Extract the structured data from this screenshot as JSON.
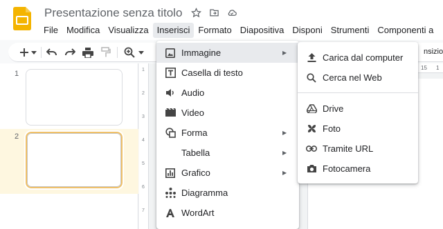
{
  "header": {
    "doc_title": "Presentazione senza titolo"
  },
  "menubar": [
    {
      "label": "File"
    },
    {
      "label": "Modifica"
    },
    {
      "label": "Visualizza"
    },
    {
      "label": "Inserisci",
      "active": true
    },
    {
      "label": "Formato"
    },
    {
      "label": "Diapositiva"
    },
    {
      "label": "Disponi"
    },
    {
      "label": "Strumenti"
    },
    {
      "label": "Componenti a"
    }
  ],
  "toolbar": {
    "clipped_text": "nsizione"
  },
  "filmstrip": {
    "slides": [
      {
        "number": "1"
      },
      {
        "number": "2",
        "selected": true
      }
    ]
  },
  "ruler": {
    "h_marks": [
      "15",
      "1"
    ],
    "v_marks": [
      "1",
      "2",
      "3",
      "4",
      "5",
      "6",
      "7"
    ]
  },
  "insert_menu": {
    "items": [
      {
        "label": "Immagine",
        "icon": "image-icon",
        "submenu": true,
        "highlighted": true
      },
      {
        "label": "Casella di testo",
        "icon": "text-box-icon"
      },
      {
        "label": "Audio",
        "icon": "audio-icon"
      },
      {
        "label": "Video",
        "icon": "video-icon"
      },
      {
        "label": "Forma",
        "icon": "shape-icon",
        "submenu": true
      },
      {
        "label": "Tabella",
        "submenu": true
      },
      {
        "label": "Grafico",
        "icon": "chart-icon",
        "submenu": true
      },
      {
        "label": "Diagramma",
        "icon": "diagram-icon"
      },
      {
        "label": "WordArt",
        "icon": "wordart-icon"
      }
    ]
  },
  "image_submenu": {
    "items": [
      {
        "label": "Carica dal computer",
        "icon": "upload-icon"
      },
      {
        "label": "Cerca nel Web",
        "icon": "search-icon"
      },
      {
        "label": "Drive",
        "icon": "drive-icon"
      },
      {
        "label": "Foto",
        "icon": "photos-icon"
      },
      {
        "label": "Tramite URL",
        "icon": "link-icon"
      },
      {
        "label": "Fotocamera",
        "icon": "camera-icon"
      }
    ]
  },
  "colors": {
    "logo": "#f4b400",
    "selection_border": "#f0c066",
    "menu_highlight": "#e8eaed"
  }
}
